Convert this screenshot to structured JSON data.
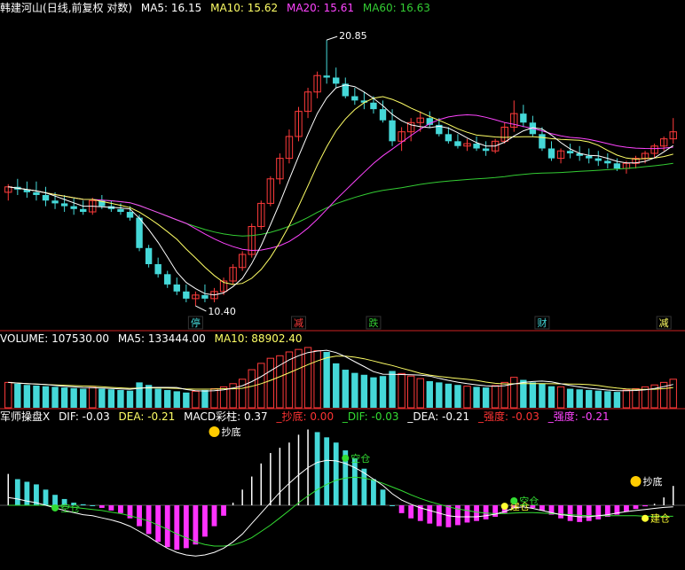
{
  "colors": {
    "background": "#000000",
    "up": "#ff3b3b",
    "down": "#45d8d8",
    "ma5": "#ffffff",
    "ma10": "#ffff66",
    "ma20": "#ff44ff",
    "ma60": "#33cc33",
    "separator": "#cc2222",
    "macd_pos": "#ffffff",
    "macd_neg": "#ff33ff",
    "dif": "#ffffff",
    "dea": "#33dd33"
  },
  "main_panel": {
    "stock": "韩建河山",
    "mode": "(日线,前复权 对数)",
    "ma5": "MA5: 16.15",
    "ma10": "MA10: 15.62",
    "ma20": "MA20: 15.61",
    "ma60": "MA60: 16.63",
    "high_label": "20.85",
    "low_label": "10.40",
    "event_tags": [
      "停",
      "减",
      "跌",
      "财",
      "减"
    ]
  },
  "volume_panel": {
    "label": "VOLUME: 107530.00",
    "ma5": "MA5: 133444.00",
    "ma10": "MA10: 88902.40"
  },
  "macd_panel": {
    "name": "军师操盘X",
    "dif": "DIF: -0.03",
    "dea": "DEA: -0.21",
    "macd": "MACD彩柱: 0.37",
    "chaodi": "_抄底: 0.00",
    "dif2": "_DIF: -0.03",
    "dea2": "_DEA: -0.21",
    "qiangdu1": "_强度: -0.03",
    "qiangdu2": "_强度: -0.21",
    "markers": {
      "build": "建仓",
      "clear": "空仓",
      "bottom": "抄底"
    }
  },
  "chart_data": {
    "type": "candlestick",
    "ylim": [
      10.0,
      22.0
    ],
    "candles": [
      [
        14.0,
        14.3,
        13.7,
        14.2
      ],
      [
        14.2,
        14.5,
        13.9,
        14.1
      ],
      [
        14.1,
        14.4,
        13.8,
        14.0
      ],
      [
        14.0,
        14.4,
        13.7,
        13.9
      ],
      [
        13.9,
        14.2,
        13.5,
        13.7
      ],
      [
        13.7,
        14.0,
        13.4,
        13.6
      ],
      [
        13.6,
        13.9,
        13.3,
        13.5
      ],
      [
        13.5,
        13.8,
        13.2,
        13.4
      ],
      [
        13.4,
        13.7,
        13.2,
        13.3
      ],
      [
        13.3,
        13.8,
        13.2,
        13.7
      ],
      [
        13.7,
        13.9,
        13.4,
        13.5
      ],
      [
        13.5,
        13.7,
        13.3,
        13.4
      ],
      [
        13.4,
        13.6,
        13.2,
        13.3
      ],
      [
        13.3,
        13.5,
        13.0,
        13.1
      ],
      [
        13.1,
        13.2,
        12.0,
        12.1
      ],
      [
        12.1,
        12.2,
        11.5,
        11.6
      ],
      [
        11.6,
        11.8,
        11.2,
        11.3
      ],
      [
        11.3,
        11.4,
        10.9,
        11.0
      ],
      [
        11.0,
        11.2,
        10.7,
        10.8
      ],
      [
        10.8,
        11.0,
        10.5,
        10.6
      ],
      [
        10.6,
        10.8,
        10.4,
        10.7
      ],
      [
        10.7,
        11.0,
        10.5,
        10.6
      ],
      [
        10.6,
        10.9,
        10.5,
        10.8
      ],
      [
        10.8,
        11.2,
        10.7,
        11.1
      ],
      [
        11.1,
        11.6,
        11.0,
        11.5
      ],
      [
        11.5,
        12.0,
        11.4,
        11.9
      ],
      [
        11.9,
        12.9,
        11.8,
        12.8
      ],
      [
        12.8,
        13.7,
        12.7,
        13.6
      ],
      [
        13.6,
        14.6,
        13.5,
        14.5
      ],
      [
        14.5,
        15.5,
        14.3,
        15.3
      ],
      [
        15.3,
        16.5,
        15.1,
        16.2
      ],
      [
        16.2,
        17.5,
        16.0,
        17.3
      ],
      [
        17.3,
        18.4,
        17.0,
        18.2
      ],
      [
        18.2,
        19.2,
        17.9,
        19.0
      ],
      [
        19.0,
        20.85,
        18.6,
        18.9
      ],
      [
        18.9,
        19.4,
        18.4,
        18.6
      ],
      [
        18.6,
        18.9,
        17.9,
        18.0
      ],
      [
        18.0,
        18.4,
        17.6,
        17.8
      ],
      [
        17.8,
        18.2,
        17.4,
        17.7
      ],
      [
        17.7,
        18.0,
        17.2,
        17.4
      ],
      [
        17.4,
        17.8,
        16.8,
        16.9
      ],
      [
        16.9,
        17.4,
        15.8,
        16.0
      ],
      [
        16.0,
        16.6,
        15.6,
        16.4
      ],
      [
        16.4,
        17.0,
        16.0,
        16.8
      ],
      [
        16.8,
        17.3,
        16.4,
        17.0
      ],
      [
        17.0,
        17.3,
        16.6,
        16.7
      ],
      [
        16.7,
        17.0,
        16.2,
        16.3
      ],
      [
        16.3,
        16.6,
        15.9,
        16.0
      ],
      [
        16.0,
        16.3,
        15.7,
        15.8
      ],
      [
        15.8,
        16.1,
        15.6,
        15.9
      ],
      [
        15.9,
        16.2,
        15.6,
        15.7
      ],
      [
        15.7,
        16.0,
        15.4,
        15.6
      ],
      [
        15.6,
        16.1,
        15.5,
        16.0
      ],
      [
        16.0,
        16.8,
        15.9,
        16.6
      ],
      [
        16.6,
        17.8,
        16.4,
        17.2
      ],
      [
        17.2,
        17.6,
        16.6,
        16.8
      ],
      [
        16.8,
        17.1,
        16.2,
        16.3
      ],
      [
        16.3,
        16.6,
        15.6,
        15.7
      ],
      [
        15.7,
        16.0,
        15.2,
        15.3
      ],
      [
        15.3,
        15.7,
        15.1,
        15.6
      ],
      [
        15.6,
        15.9,
        15.3,
        15.5
      ],
      [
        15.5,
        15.8,
        15.2,
        15.4
      ],
      [
        15.4,
        15.7,
        15.1,
        15.3
      ],
      [
        15.3,
        15.6,
        15.0,
        15.2
      ],
      [
        15.2,
        15.5,
        14.9,
        15.1
      ],
      [
        15.1,
        15.3,
        14.8,
        14.9
      ],
      [
        14.9,
        15.2,
        14.7,
        15.1
      ],
      [
        15.1,
        15.4,
        14.9,
        15.3
      ],
      [
        15.3,
        15.6,
        15.1,
        15.5
      ],
      [
        15.5,
        15.9,
        15.3,
        15.8
      ],
      [
        15.8,
        16.2,
        15.6,
        16.1
      ],
      [
        16.1,
        17.0,
        15.9,
        16.4
      ]
    ],
    "volume": [
      40,
      38,
      36,
      35,
      34,
      33,
      32,
      31,
      30,
      32,
      30,
      29,
      28,
      27,
      40,
      36,
      30,
      28,
      26,
      24,
      26,
      28,
      30,
      33,
      38,
      45,
      60,
      70,
      78,
      82,
      88,
      92,
      95,
      90,
      88,
      70,
      60,
      55,
      52,
      48,
      50,
      58,
      54,
      50,
      46,
      42,
      40,
      38,
      36,
      34,
      33,
      32,
      35,
      40,
      48,
      44,
      40,
      38,
      34,
      33,
      30,
      29,
      28,
      27,
      26,
      25,
      28,
      30,
      33,
      36,
      40,
      45
    ],
    "macd": [
      0.6,
      0.5,
      0.45,
      0.4,
      0.3,
      0.2,
      0.12,
      0.05,
      0.02,
      0.0,
      -0.05,
      -0.1,
      -0.15,
      -0.25,
      -0.4,
      -0.55,
      -0.7,
      -0.8,
      -0.85,
      -0.82,
      -0.75,
      -0.6,
      -0.4,
      -0.2,
      0.05,
      0.3,
      0.55,
      0.8,
      1.0,
      1.1,
      1.2,
      1.35,
      1.45,
      1.4,
      1.3,
      1.2,
      1.05,
      0.9,
      0.7,
      0.5,
      0.3,
      0.0,
      -0.15,
      -0.25,
      -0.3,
      -0.35,
      -0.4,
      -0.42,
      -0.38,
      -0.33,
      -0.3,
      -0.27,
      -0.22,
      -0.15,
      -0.05,
      0.0,
      -0.05,
      -0.1,
      -0.18,
      -0.25,
      -0.3,
      -0.32,
      -0.3,
      -0.27,
      -0.22,
      -0.18,
      -0.12,
      -0.07,
      -0.02,
      0.03,
      0.15,
      0.37
    ],
    "dif": [
      0.15,
      0.12,
      0.08,
      0.05,
      0.0,
      -0.05,
      -0.1,
      -0.14,
      -0.18,
      -0.2,
      -0.24,
      -0.28,
      -0.33,
      -0.4,
      -0.5,
      -0.6,
      -0.72,
      -0.82,
      -0.9,
      -0.95,
      -0.97,
      -0.95,
      -0.9,
      -0.82,
      -0.7,
      -0.55,
      -0.35,
      -0.15,
      0.05,
      0.25,
      0.42,
      0.58,
      0.72,
      0.82,
      0.86,
      0.85,
      0.8,
      0.72,
      0.62,
      0.5,
      0.38,
      0.22,
      0.1,
      0.02,
      -0.05,
      -0.1,
      -0.15,
      -0.2,
      -0.22,
      -0.22,
      -0.22,
      -0.2,
      -0.17,
      -0.12,
      -0.05,
      -0.03,
      -0.06,
      -0.1,
      -0.14,
      -0.18,
      -0.2,
      -0.22,
      -0.22,
      -0.2,
      -0.18,
      -0.15,
      -0.12,
      -0.1,
      -0.08,
      -0.06,
      -0.04,
      -0.03
    ],
    "dea": [
      0.0,
      0.0,
      0.0,
      0.0,
      0.0,
      -0.01,
      -0.02,
      -0.04,
      -0.06,
      -0.08,
      -0.1,
      -0.13,
      -0.16,
      -0.2,
      -0.25,
      -0.3,
      -0.38,
      -0.46,
      -0.55,
      -0.62,
      -0.7,
      -0.75,
      -0.78,
      -0.78,
      -0.76,
      -0.7,
      -0.62,
      -0.5,
      -0.38,
      -0.24,
      -0.1,
      0.05,
      0.18,
      0.3,
      0.4,
      0.48,
      0.52,
      0.54,
      0.52,
      0.48,
      0.42,
      0.35,
      0.28,
      0.2,
      0.13,
      0.07,
      0.02,
      -0.03,
      -0.07,
      -0.1,
      -0.13,
      -0.15,
      -0.16,
      -0.16,
      -0.15,
      -0.14,
      -0.14,
      -0.15,
      -0.16,
      -0.17,
      -0.18,
      -0.19,
      -0.2,
      -0.2,
      -0.2,
      -0.2,
      -0.2,
      -0.2,
      -0.21,
      -0.21,
      -0.21,
      -0.21
    ]
  }
}
